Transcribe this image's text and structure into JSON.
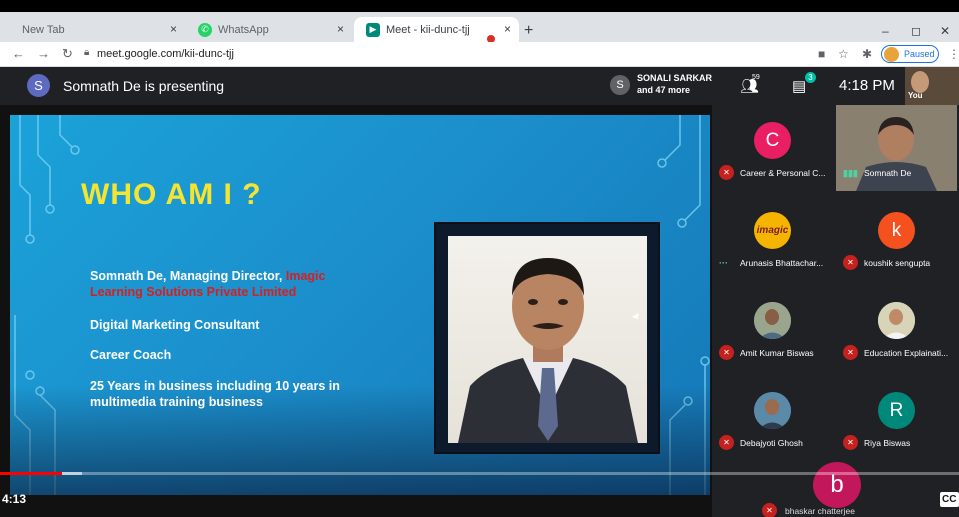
{
  "browser": {
    "tabs": [
      {
        "label": "New Tab",
        "close": "×"
      },
      {
        "label": "WhatsApp",
        "close": "×"
      },
      {
        "label": "Meet - kii-dunc-tjj",
        "close": "×"
      }
    ],
    "new_tab": "+",
    "url": "meet.google.com/kii-dunc-tjj",
    "profile_status": "Paused",
    "window_controls": [
      "–",
      "◻",
      "✕"
    ]
  },
  "meet": {
    "presenter_initial": "S",
    "presenter_text": "Somnath De is presenting",
    "speaker_initial": "S",
    "speaker_name_line1": "SONALI SARKAR",
    "speaker_name_line2": "and 47 more",
    "participant_count": "59",
    "chat_badge": "3",
    "clock": "4:18 PM",
    "self_label": "You"
  },
  "slide": {
    "title": "WHO AM I ?",
    "line1_plain": "Somnath De, Managing Director, ",
    "line1_red": "Imagic",
    "line2_red": "Learning Solutions Private Limited",
    "line3": "Digital Marketing Consultant",
    "line4": "Career Coach",
    "line5": "25 Years in business including 10 years in",
    "line6": "multimedia training business"
  },
  "participants": [
    {
      "name": "Career & Personal C...",
      "initial": "C",
      "color": "#e91e63",
      "muted": true
    },
    {
      "name": "Somnath De",
      "initial": "",
      "color": "",
      "speaking": true
    },
    {
      "name": "Arunasis Bhattachar...",
      "initial": "imagic",
      "color": "#f5b400",
      "speaking": true
    },
    {
      "name": "koushik sengupta",
      "initial": "k",
      "color": "#f4511e",
      "muted": true
    },
    {
      "name": "Amit Kumar Biswas",
      "initial": "",
      "color": "#8d9a8a",
      "muted": true
    },
    {
      "name": "Education Explainati...",
      "initial": "",
      "color": "#e8e2c8",
      "muted": true
    },
    {
      "name": "Debajyoti Ghosh",
      "initial": "",
      "color": "#3a6a8a",
      "muted": true
    },
    {
      "name": "Riya Biswas",
      "initial": "R",
      "color": "#00897b",
      "muted": true
    }
  ],
  "bottom_participant": {
    "name": "bhaskar chatterjee",
    "initial": "b",
    "color": "#c2185b"
  },
  "player": {
    "timecode": "4:13",
    "cc": "CC",
    "progress_fraction": 0.065,
    "buffered_fraction": 0.085
  }
}
